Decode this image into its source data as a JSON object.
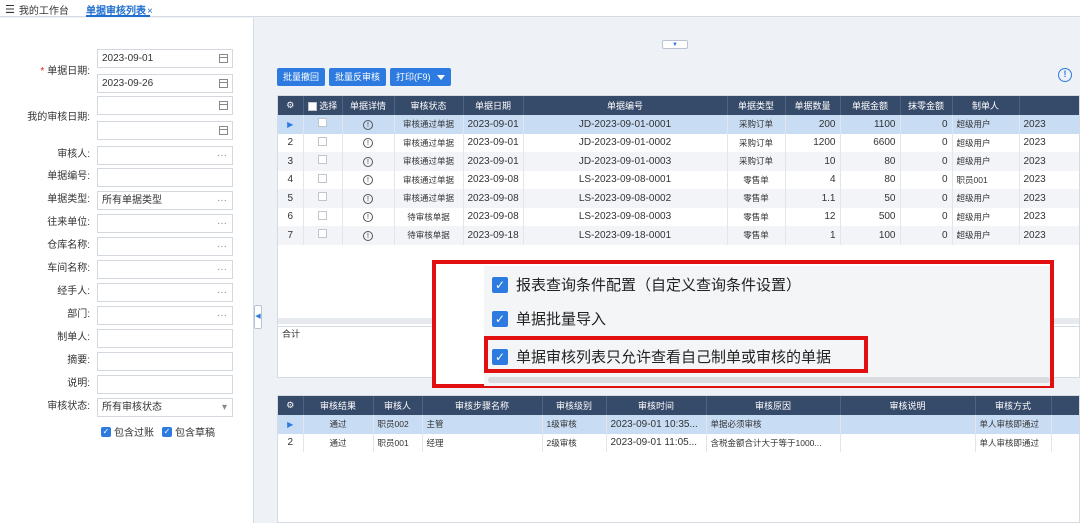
{
  "topbar": {
    "menu_icon": "☰",
    "home_tab": "我的工作台",
    "active_tab": "单据审核列表",
    "close_glyph": "×"
  },
  "filters": {
    "doc_date_label": "单据日期:",
    "doc_date_from": "2023-09-01",
    "doc_date_to": "2023-09-26",
    "my_audit_date_label": "我的审核日期:",
    "auditor_label": "审核人:",
    "doc_no_label": "单据编号:",
    "doc_type_label": "单据类型:",
    "doc_type_value": "所有单据类型",
    "partner_label": "往来单位:",
    "warehouse_label": "仓库名称:",
    "workshop_label": "车间名称:",
    "handler_label": "经手人:",
    "dept_label": "部门:",
    "maker_label": "制单人:",
    "summary_label": "摘要:",
    "remark_label": "说明:",
    "audit_status_label": "审核状态:",
    "audit_status_value": "所有审核状态",
    "ellipsis": "···",
    "include_posted": "包含过账",
    "include_draft": "包含草稿"
  },
  "toolbar": {
    "batch_revoke": "批量撤回",
    "batch_unaudit": "批量反审核",
    "print": "打印(F9)",
    "info_icon": "!"
  },
  "main_grid": {
    "headers": [
      "选择",
      "单据详情",
      "审核状态",
      "单据日期",
      "单据编号",
      "单据类型",
      "单据数量",
      "单据金额",
      "抹零金额",
      "制单人"
    ],
    "rows": [
      {
        "no": "▶",
        "status": "审核通过单据",
        "date": "2023-09-01",
        "code": "JD-2023-09-01-0001",
        "type": "采购订单",
        "qty": "200",
        "amount": "1100",
        "round": "0",
        "maker": "超级用户",
        "extra": "2023"
      },
      {
        "no": "2",
        "status": "审核通过单据",
        "date": "2023-09-01",
        "code": "JD-2023-09-01-0002",
        "type": "采购订单",
        "qty": "1200",
        "amount": "6600",
        "round": "0",
        "maker": "超级用户",
        "extra": "2023"
      },
      {
        "no": "3",
        "status": "审核通过单据",
        "date": "2023-09-01",
        "code": "JD-2023-09-01-0003",
        "type": "采购订单",
        "qty": "10",
        "amount": "80",
        "round": "0",
        "maker": "超级用户",
        "extra": "2023"
      },
      {
        "no": "4",
        "status": "审核通过单据",
        "date": "2023-09-08",
        "code": "LS-2023-09-08-0001",
        "type": "零售单",
        "qty": "4",
        "amount": "80",
        "round": "0",
        "maker": "职员001",
        "extra": "2023"
      },
      {
        "no": "5",
        "status": "审核通过单据",
        "date": "2023-09-08",
        "code": "LS-2023-09-08-0002",
        "type": "零售单",
        "qty": "1.1",
        "amount": "50",
        "round": "0",
        "maker": "超级用户",
        "extra": "2023"
      },
      {
        "no": "6",
        "status": "待审核单据",
        "date": "2023-09-08",
        "code": "LS-2023-09-08-0003",
        "type": "零售单",
        "qty": "12",
        "amount": "500",
        "round": "0",
        "maker": "超级用户",
        "extra": "2023"
      },
      {
        "no": "7",
        "status": "待审核单据",
        "date": "2023-09-18",
        "code": "LS-2023-09-18-0001",
        "type": "零售单",
        "qty": "1",
        "amount": "100",
        "round": "0",
        "maker": "超级用户",
        "extra": "2023"
      }
    ],
    "total_label": "合计"
  },
  "audit_grid": {
    "headers": [
      "审核结果",
      "审核人",
      "审核步骤名称",
      "审核级别",
      "审核时间",
      "审核原因",
      "审核说明",
      "审核方式"
    ],
    "rows": [
      {
        "no": "▶",
        "result": "通过",
        "auditor": "职员002",
        "step": "主管",
        "level": "1级审核",
        "time": "2023-09-01 10:35...",
        "reason": "单据必须审核",
        "note": "",
        "mode": "单人审核即通过"
      },
      {
        "no": "2",
        "result": "通过",
        "auditor": "职员001",
        "step": "经理",
        "level": "2级审核",
        "time": "2023-09-01 11:05...",
        "reason": "含税金额合计大于等于1000...",
        "note": "",
        "mode": "单人审核即通过"
      }
    ]
  },
  "popup": {
    "options": [
      "报表查询条件配置（自定义查询条件设置）",
      "单据批量导入",
      "单据审核列表只允许查看自己制单或审核的单据"
    ],
    "check_glyph": "✓"
  },
  "colors": {
    "accent": "#2d7be0",
    "header_bg": "#364a6a",
    "highlight": "#e10f0f",
    "selected_row": "#c8dcf4"
  }
}
